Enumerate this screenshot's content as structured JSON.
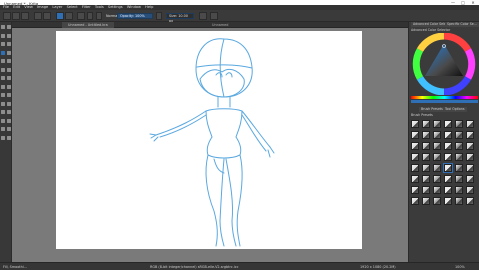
{
  "app": {
    "title": "Unnamed * - Krita"
  },
  "window_controls": [
    "—",
    "□",
    "✕"
  ],
  "menu": [
    "File",
    "Edit",
    "View",
    "Image",
    "Layer",
    "Select",
    "Filter",
    "Tools",
    "Settings",
    "Window",
    "Help"
  ],
  "toolbar": {
    "blend_mode": "Normal",
    "opacity_label": "Opacity:",
    "opacity_value": "100%",
    "size_label": "Size:",
    "size_value": "10.00 px"
  },
  "document": {
    "tab_label": "Unnamed - Untitled.kra",
    "tab_hint": "Unnamed"
  },
  "dock": {
    "tabs": [
      "Advanced Color Selector",
      "Specific Color Se..."
    ],
    "color_selector_title": "Advanced Color Selector",
    "preset_tabs": [
      "Brush Presets",
      "Tool Options"
    ],
    "presets_title": "Brush Presets",
    "brush_presets_count": 48,
    "colors": {
      "accent": "#2f6fb5",
      "panel": "#3b3b3b"
    }
  },
  "status": {
    "left": "Fill, Smoothi...",
    "center": "RGB (8-bit integer/channel)  sRGB-elle-V2-srgbtrc.icc",
    "right": "1920 x 1080 (20.2M)",
    "zoom": "100%"
  }
}
